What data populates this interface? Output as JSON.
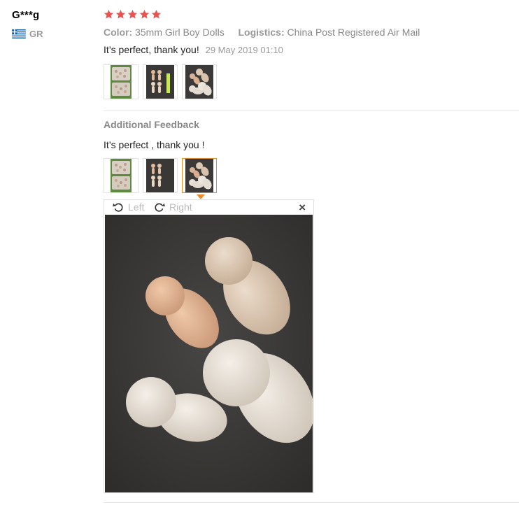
{
  "user": {
    "name": "G***g",
    "country_code": "GR",
    "flag_icon": "greece-flag-icon"
  },
  "rating": {
    "stars": 5,
    "max": 5,
    "color": "#e8524f"
  },
  "order_info": {
    "color_label": "Color:",
    "color_value": "35mm Girl Boy Dolls",
    "logistics_label": "Logistics:",
    "logistics_value": "China Post Registered Air Mail"
  },
  "review": {
    "text": "It’s perfect, thank you!",
    "date": "29 May 2019 01:10"
  },
  "photos": [
    {
      "icon": "bagged-dolls-photo"
    },
    {
      "icon": "standing-dolls-photo"
    },
    {
      "icon": "peg-dolls-closeup-photo"
    }
  ],
  "additional": {
    "title": "Additional Feedback",
    "text": "It’s perfect , thank you !",
    "selected_photo_index": 2
  },
  "viewer": {
    "rotate_left_label": "Left",
    "rotate_right_label": "Right",
    "close_label": "×",
    "image_icon": "peg-dolls-enlarged-photo"
  },
  "colors": {
    "accent": "#e88b2a",
    "star": "#e8524f",
    "muted": "#999999"
  }
}
